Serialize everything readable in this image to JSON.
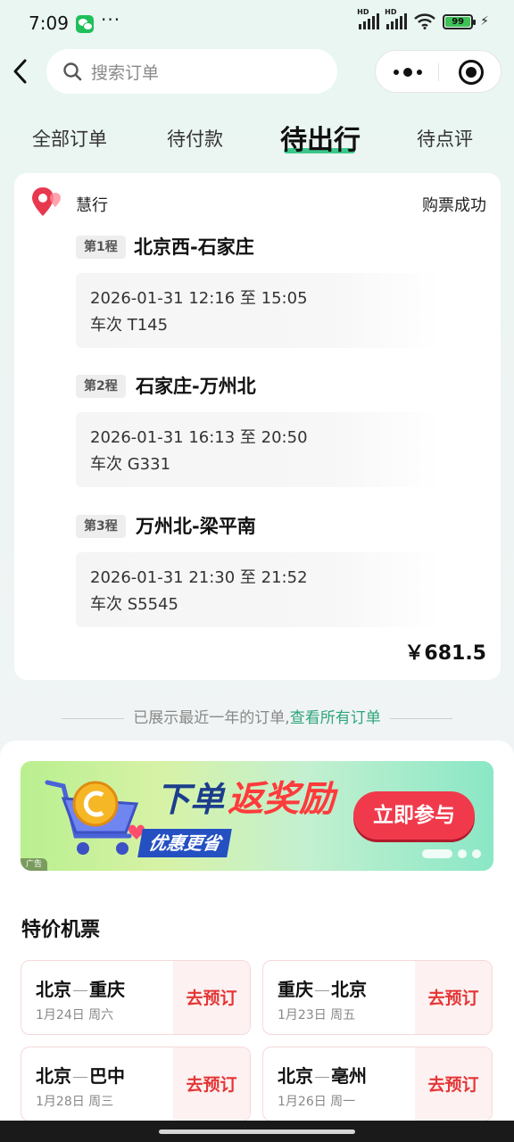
{
  "status_bar": {
    "time": "7:09",
    "dots": "···",
    "battery": "99"
  },
  "search": {
    "placeholder": "搜索订单"
  },
  "tabs": [
    {
      "label": "全部订单"
    },
    {
      "label": "待付款"
    },
    {
      "label": "待出行",
      "active": true
    },
    {
      "label": "待点评"
    }
  ],
  "order": {
    "vendor": "慧行",
    "status": "购票成功",
    "legs": [
      {
        "tag": "第1程",
        "route": "北京西-石家庄",
        "time": "2026-01-31 12:16 至 15:05",
        "train": "车次 T145"
      },
      {
        "tag": "第2程",
        "route": "石家庄-万州北",
        "time": "2026-01-31 16:13 至 20:50",
        "train": "车次 G331"
      },
      {
        "tag": "第3程",
        "route": "万州北-梁平南",
        "time": "2026-01-31 21:30 至 21:52",
        "train": "车次 S5545"
      }
    ],
    "price": "￥681.5"
  },
  "list_note": {
    "text": "已展示最近一年的订单,",
    "link": "查看所有订单"
  },
  "banner": {
    "title_a": "下单",
    "title_b": "返奖励",
    "subtitle": "优惠更省",
    "cta": "立即参与",
    "ad_label": "广告"
  },
  "deals": {
    "title": "特价机票",
    "items": [
      {
        "from": "北京",
        "to": "重庆",
        "date": "1月24日 周六",
        "action": "去预订"
      },
      {
        "from": "重庆",
        "to": "北京",
        "date": "1月23日 周五",
        "action": "去预订"
      },
      {
        "from": "北京",
        "to": "巴中",
        "date": "1月28日 周三",
        "action": "去预订"
      },
      {
        "from": "北京",
        "to": "亳州",
        "date": "1月26日 周一",
        "action": "去预订"
      }
    ]
  },
  "colors": {
    "accent": "#3cc78a",
    "link": "#2fa57a",
    "price_action": "#e43535",
    "cta": "#f03a4c"
  }
}
